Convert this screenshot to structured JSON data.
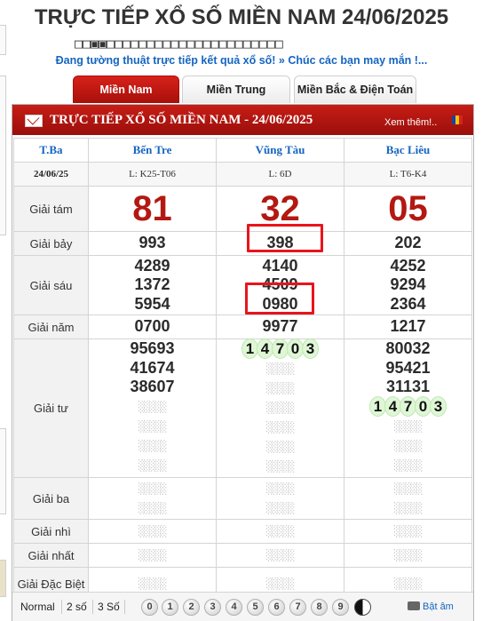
{
  "page": {
    "title": "TRỰC TIẾP XỔ SỐ MIỀN NAM 24/06/2025",
    "title_boxes": "□□▣▣□□□□□□□□□□□□□□□□□□□□□□",
    "tagline": "Đang tường thuật trực tiếp kết quả xổ số! » Chúc các bạn may mắn !..."
  },
  "tabs": [
    {
      "label": "Miền Nam",
      "active": true
    },
    {
      "label": "Miền Trung",
      "active": false
    },
    {
      "label": "Miền Bắc & Điện Toán",
      "active": false
    }
  ],
  "panel": {
    "title": "TRỰC TIẾP XỔ SỐ MIỀN NAM - 24/06/2025",
    "see_more": "Xem thêm!..",
    "accent_color": "#c71d16"
  },
  "table": {
    "day": "T.Ba",
    "date": "24/06/25",
    "provinces": [
      {
        "name": "Bến Tre",
        "code": "L: K25-T06"
      },
      {
        "name": "Vũng Tàu",
        "code": "L: 6D"
      },
      {
        "name": "Bạc Liêu",
        "code": "L: T6-K4"
      }
    ],
    "labels": {
      "g8": "Giải tám",
      "g7": "Giải bảy",
      "g6": "Giải sáu",
      "g5": "Giải năm",
      "g4": "Giải tư",
      "g3": "Giải ba",
      "g2": "Giải nhì",
      "g1": "Giải nhất",
      "db": "Giải Đặc Biệt"
    },
    "g8": [
      "81",
      "32",
      "05"
    ],
    "g7": [
      "993",
      "398",
      "202"
    ],
    "g6": [
      [
        "4289",
        "1372",
        "5954"
      ],
      [
        "4140",
        "4509",
        "0980"
      ],
      [
        "4252",
        "9294",
        "2364"
      ]
    ],
    "g5": [
      "0700",
      "9977",
      "1217"
    ],
    "g4": {
      "ben_tre": [
        "95693",
        "41674",
        "38607"
      ],
      "vung_tau_rolling": [
        "1",
        "4",
        "7",
        "0",
        "3"
      ],
      "bac_lieu": [
        "80032",
        "95421",
        "31131"
      ],
      "bac_lieu_rolling": [
        "1",
        "4",
        "7",
        "0",
        "3"
      ]
    },
    "placeholder": "░░░░░"
  },
  "footer": {
    "modes": [
      "Normal",
      "2 số",
      "3 Số"
    ],
    "digits": [
      "0",
      "1",
      "2",
      "3",
      "4",
      "5",
      "6",
      "7",
      "8",
      "9"
    ],
    "sound_label": "Bật âm"
  }
}
